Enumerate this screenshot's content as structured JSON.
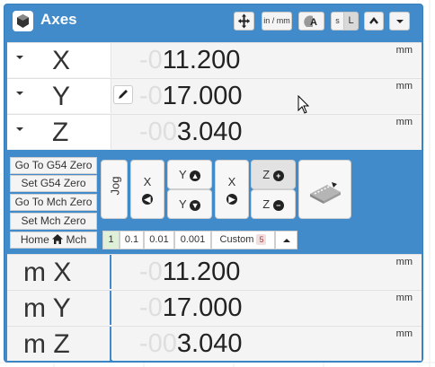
{
  "header": {
    "title": "Axes",
    "units_toggle": "in / mm",
    "auto_label": "A",
    "s_label": "s",
    "l_label": "L"
  },
  "work_dro": [
    {
      "axis": "X",
      "ghost": "-0",
      "value": "11.200",
      "unit": "mm"
    },
    {
      "axis": "Y",
      "ghost": "-0",
      "value": "17.000",
      "unit": "mm"
    },
    {
      "axis": "Z",
      "ghost": "-00",
      "value": "3.040",
      "unit": "mm"
    }
  ],
  "controls": {
    "goto_g54": "Go To G54 Zero",
    "set_g54": "Set G54 Zero",
    "goto_mch": "Go To Mch Zero",
    "set_mch": "Set Mch Zero",
    "home_left": "Home",
    "home_right": "Mch"
  },
  "jog": {
    "label": "Jog",
    "x": "X",
    "y": "Y",
    "z": "Z"
  },
  "steps": {
    "options": [
      "1",
      "0.1",
      "0.01",
      "0.001"
    ],
    "custom_label": "Custom",
    "custom_value": "5"
  },
  "machine_dro": [
    {
      "axis": "m X",
      "ghost": "-0",
      "value": "11.200",
      "unit": "mm"
    },
    {
      "axis": "m Y",
      "ghost": "-0",
      "value": "17.000",
      "unit": "mm"
    },
    {
      "axis": "m Z",
      "ghost": "-00",
      "value": "3.040",
      "unit": "mm"
    }
  ]
}
